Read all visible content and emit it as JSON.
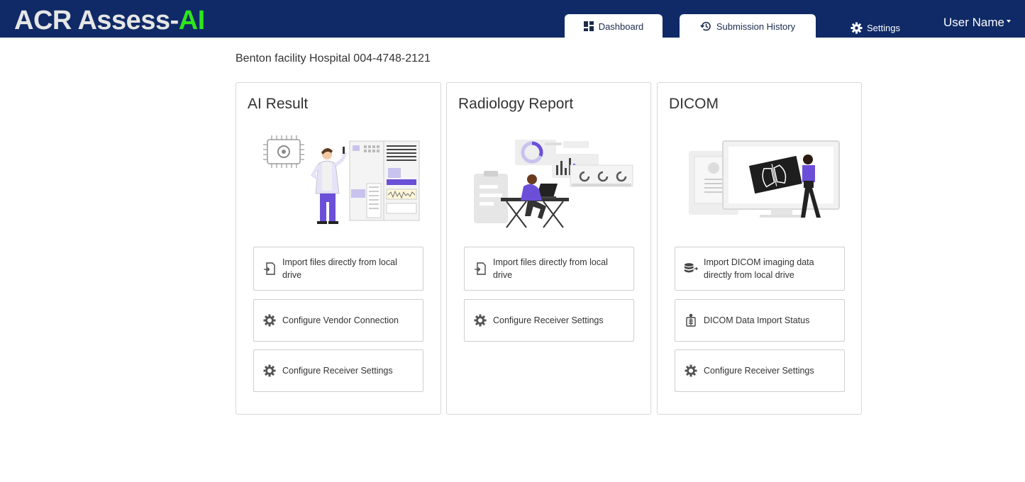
{
  "header": {
    "brand_main": "ACR Assess-",
    "brand_accent": "AI",
    "tabs": [
      {
        "label": "Dashboard",
        "icon": "dashboard-icon"
      },
      {
        "label": "Submission History",
        "icon": "history-icon"
      }
    ],
    "settings_label": "Settings",
    "user_label": "User Name"
  },
  "facility": "Benton facility Hospital 004-4748-2121",
  "cards": [
    {
      "title": "AI Result",
      "actions": [
        {
          "label": "Import files directly from local drive",
          "icon": "file-import-icon"
        },
        {
          "label": "Configure Vendor Connection",
          "icon": "gear-icon"
        },
        {
          "label": "Configure Receiver Settings",
          "icon": "gear-icon"
        }
      ]
    },
    {
      "title": "Radiology Report",
      "actions": [
        {
          "label": "Import files directly from local drive",
          "icon": "file-import-icon"
        },
        {
          "label": "Configure Receiver Settings",
          "icon": "gear-icon"
        }
      ]
    },
    {
      "title": "DICOM",
      "actions": [
        {
          "label": "Import DICOM imaging data directly from local drive",
          "icon": "database-import-icon"
        },
        {
          "label": "DICOM Data Import Status",
          "icon": "xray-person-icon"
        },
        {
          "label": "Configure Receiver Settings",
          "icon": "gear-icon"
        }
      ]
    }
  ],
  "colors": {
    "header_bg": "#0f2a66",
    "brand_accent": "#2ee61c",
    "illustration_accent": "#6c4fd8"
  }
}
